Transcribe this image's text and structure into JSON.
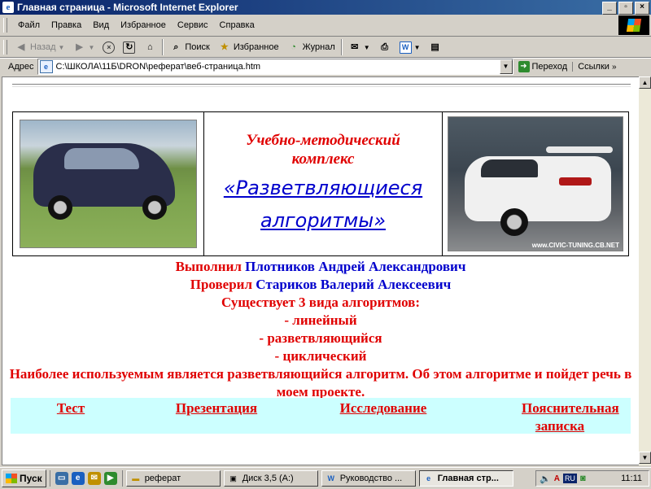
{
  "window": {
    "title": "Главная страница - Microsoft Internet Explorer"
  },
  "menu": [
    "Файл",
    "Правка",
    "Вид",
    "Избранное",
    "Сервис",
    "Справка"
  ],
  "toolbar": {
    "back": "Назад",
    "search": "Поиск",
    "favorites": "Избранное",
    "history": "Журнал"
  },
  "address": {
    "label": "Адрес",
    "value": "C:\\ШКОЛА\\11Б\\DRON\\реферат\\веб-страница.htm",
    "go": "Переход",
    "links": "Ссылки"
  },
  "page": {
    "subtitle": "Учебно-методический комплекс",
    "title": "«Разветвляющиеся алгоритмы»",
    "photo2_watermark": "www.CIVIC-TUNING.CB.NET",
    "performed_label": "Выполнил",
    "performed_name": "Плотников Андрей Александрович",
    "checked_label": "Проверил",
    "checked_name": "Стариков Валерий Алексеевич",
    "types_heading": "Существует 3 вида алгоритмов:",
    "types": [
      "- линейный",
      "- разветвляющийся",
      "- циклический"
    ],
    "paragraph": "Наиболее используемым является разветвляющийся алгоритм. Об этом алгоритме и пойдет речь в моем проекте.",
    "nav": [
      "Тест",
      "Презентация",
      "Исследование",
      "Пояснительная записка"
    ]
  },
  "taskbar": {
    "start": "Пуск",
    "items": [
      "реферат",
      "Диск 3,5 (A:)",
      "Руководство ...",
      "Главная стр..."
    ],
    "lang": "RU",
    "clock": "11:11"
  },
  "colors": {
    "accent_red": "#e00000",
    "accent_blue": "#0000cc",
    "nav_bg": "#ccffff"
  }
}
